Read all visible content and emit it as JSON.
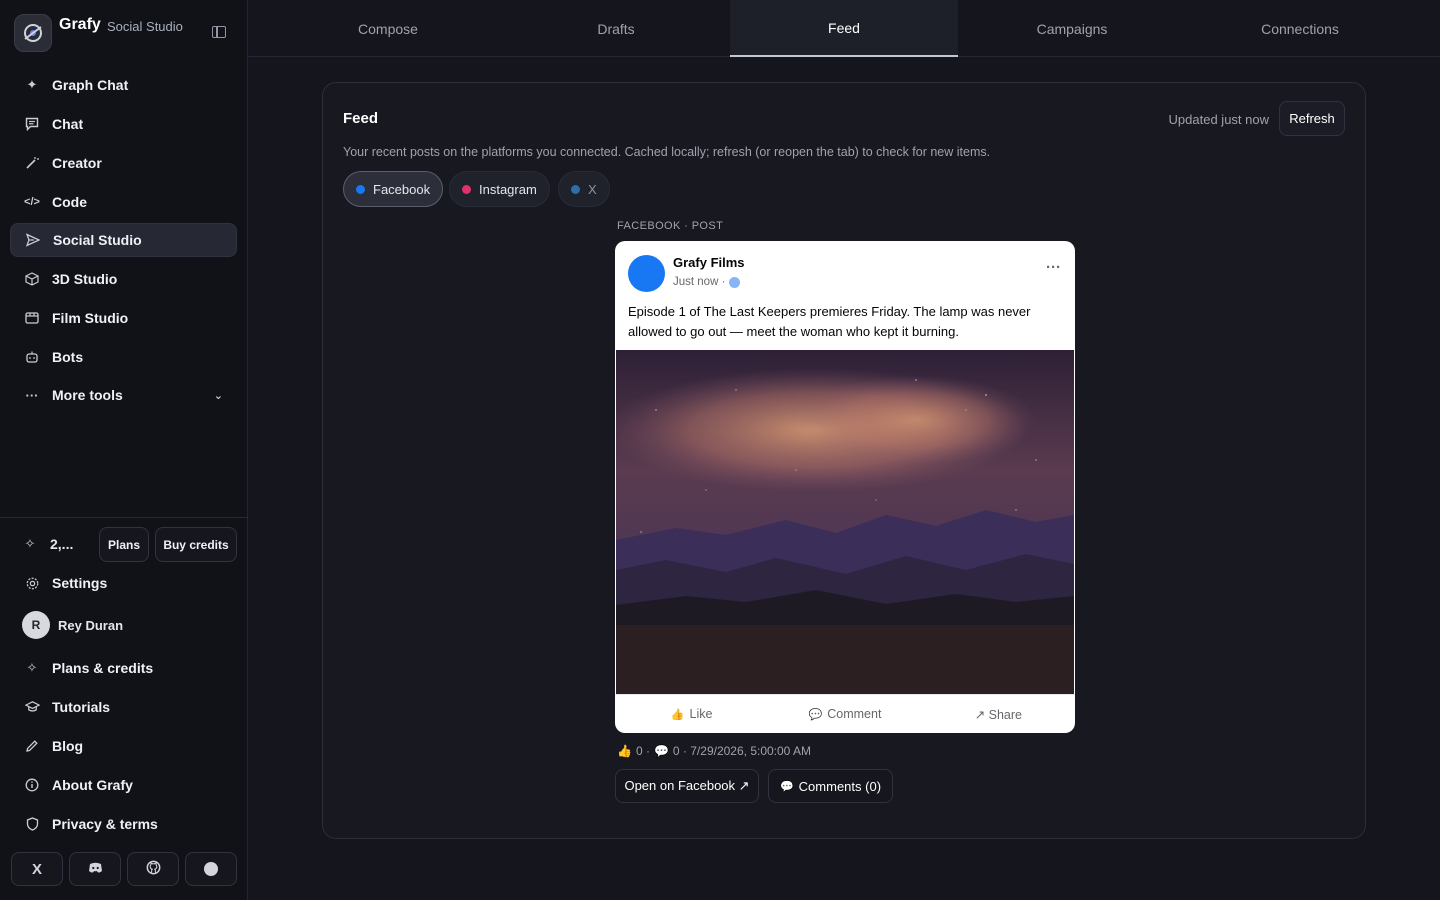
{
  "brand": {
    "name": "Grafy",
    "subtitle": "Social Studio"
  },
  "nav": [
    {
      "label": "Graph Chat",
      "icon": "sparkle-icon"
    },
    {
      "label": "Chat",
      "icon": "chat-icon"
    },
    {
      "label": "Creator",
      "icon": "wand-icon"
    },
    {
      "label": "Code",
      "icon": "code-icon"
    },
    {
      "label": "Social Studio",
      "icon": "send-icon",
      "active": true
    },
    {
      "label": "3D Studio",
      "icon": "cube-icon"
    },
    {
      "label": "Film Studio",
      "icon": "film-icon"
    },
    {
      "label": "Bots",
      "icon": "bot-icon"
    },
    {
      "label": "More tools",
      "icon": "dots-icon"
    }
  ],
  "credits": {
    "value": "2,...",
    "plans_label": "Plans",
    "buy_label": "Buy credits"
  },
  "settings_label": "Settings",
  "user": {
    "initial": "R",
    "name": "Rey Duran"
  },
  "footer_nav": [
    {
      "label": "Plans & credits"
    },
    {
      "label": "Tutorials"
    },
    {
      "label": "Blog"
    },
    {
      "label": "About Grafy"
    },
    {
      "label": "Privacy & terms"
    }
  ],
  "social_links": {
    "x": "X"
  },
  "tabs": [
    {
      "label": "Compose"
    },
    {
      "label": "Drafts"
    },
    {
      "label": "Feed",
      "active": true
    },
    {
      "label": "Campaigns"
    },
    {
      "label": "Connections"
    }
  ],
  "feed": {
    "title": "Feed",
    "updated": "Updated just now",
    "refresh_label": "Refresh",
    "description": "Your recent posts on the platforms you connected. Cached locally; refresh (or reopen the tab) to check for new items.",
    "filters": [
      {
        "label": "Facebook",
        "color": "#1877f2",
        "active": true
      },
      {
        "label": "Instagram",
        "color": "#e1306c"
      },
      {
        "label": "X",
        "color": "#1d9bf0"
      }
    ],
    "post": {
      "meta": "FACEBOOK · POST",
      "author": "Grafy Films",
      "time": "Just now ·",
      "text": "Episode 1 of The Last Keepers premieres Friday. The lamp was never allowed to go out — meet the woman who kept it burning.",
      "actions": {
        "like": "Like",
        "comment": "Comment",
        "share": "↗ Share"
      },
      "stats": {
        "likes": "0 ·",
        "comments": "0 · 7/29/2026, 5:00:00 AM"
      },
      "open_label": "Open on Facebook ↗",
      "comments_label": "Comments (0)"
    }
  }
}
